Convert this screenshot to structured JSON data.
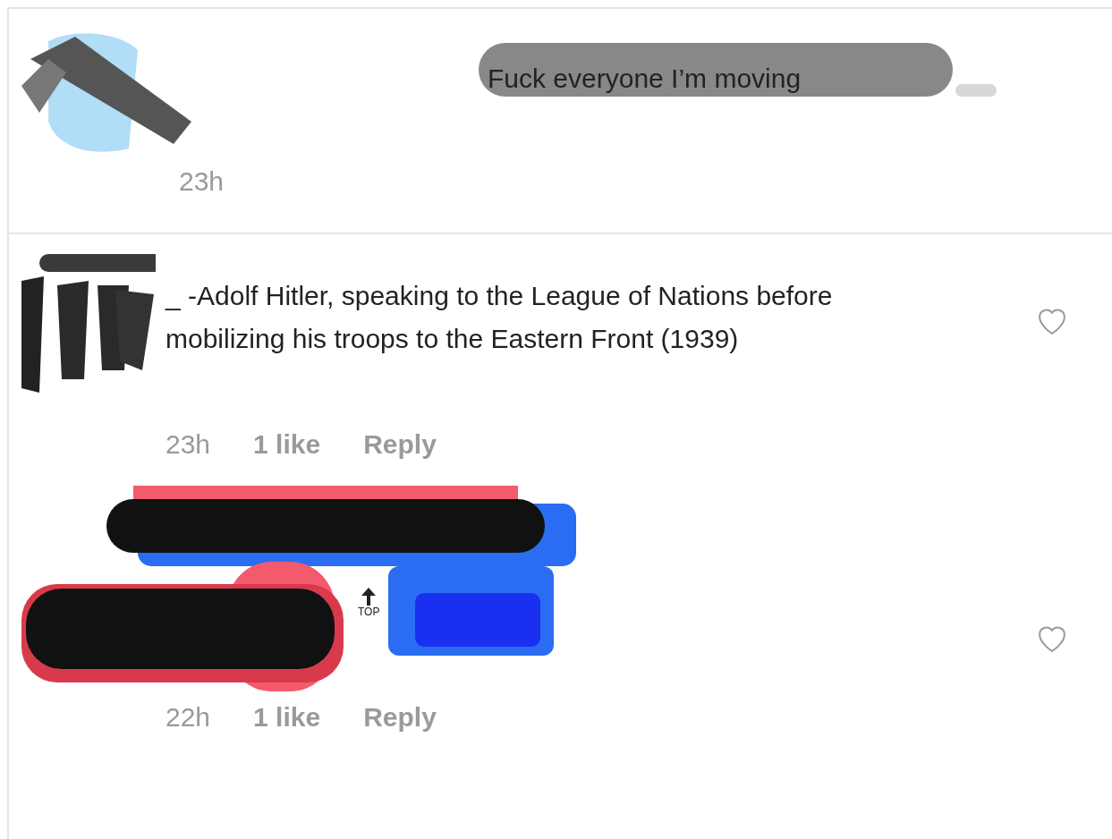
{
  "comments": [
    {
      "kind": "caption",
      "text": "Fuck everyone I’m moving",
      "time": "23h"
    },
    {
      "kind": "comment",
      "text": "_ -Adolf Hitler, speaking to the League of Nations before mobilizing his troops to the Eastern Front (1939)",
      "time": "23h",
      "likes": "1 like",
      "reply": "Reply",
      "liked": false
    },
    {
      "kind": "reply",
      "badge": "TOP",
      "time": "22h",
      "likes": "1 like",
      "reply": "Reply",
      "liked": false
    }
  ]
}
